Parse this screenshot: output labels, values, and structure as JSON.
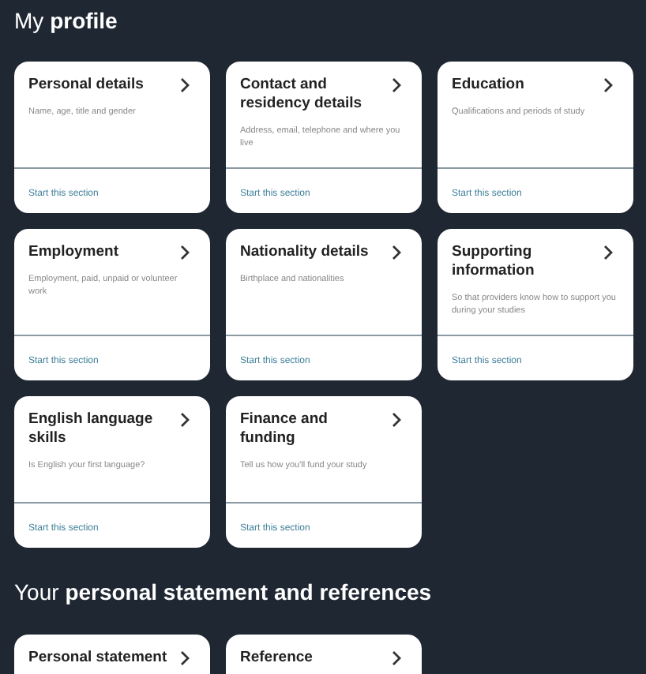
{
  "sections": [
    {
      "heading": "My **profile**",
      "cards": [
        {
          "title": "Personal details",
          "description": "Name, age, title and gender",
          "link": "Start this section"
        },
        {
          "title": "Contact and residency details",
          "description": "Address, email, telephone and where you live",
          "link": "Start this section"
        },
        {
          "title": "Education",
          "description": "Qualifications and periods of study",
          "link": "Start this section"
        },
        {
          "title": "Employment",
          "description": "Employment, paid, unpaid or volunteer work",
          "link": "Start this section"
        },
        {
          "title": "Nationality details",
          "description": "Birthplace and nationalities",
          "link": "Start this section"
        },
        {
          "title": "Supporting information",
          "description": "So that providers know how to support you during your studies",
          "link": "Start this section"
        },
        {
          "title": "English language skills",
          "description": "Is English your first language?",
          "link": "Start this section"
        },
        {
          "title": "Finance and funding",
          "description": "Tell us how you'll fund your study",
          "link": "Start this section"
        }
      ]
    },
    {
      "heading": "Your **personal statement and references**",
      "cards": [
        {
          "title": "Personal statement"
        },
        {
          "title": "Reference"
        }
      ]
    }
  ]
}
